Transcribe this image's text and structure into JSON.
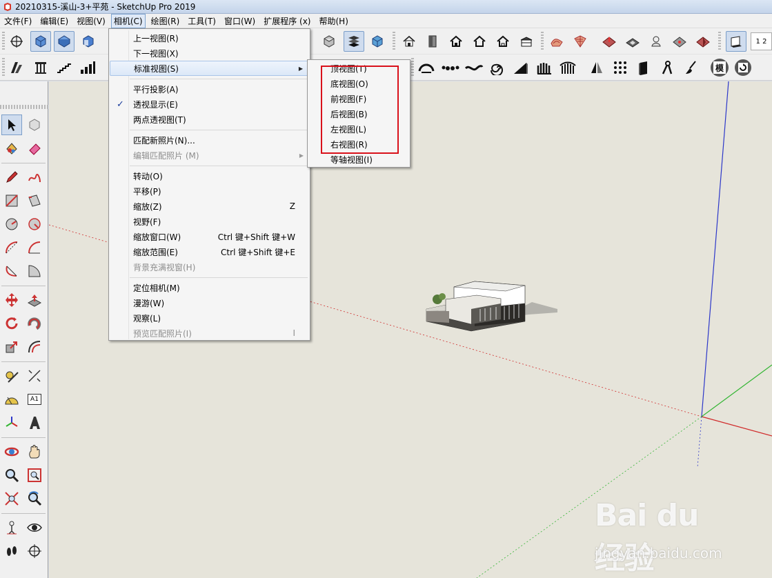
{
  "window": {
    "title": "20210315-溪山-3+平苑 - SketchUp Pro 2019"
  },
  "menubar": [
    {
      "label": "文件(F)"
    },
    {
      "label": "编辑(E)"
    },
    {
      "label": "视图(V)"
    },
    {
      "label": "相机(C)"
    },
    {
      "label": "绘图(R)"
    },
    {
      "label": "工具(T)"
    },
    {
      "label": "窗口(W)"
    },
    {
      "label": "扩展程序 (x)"
    },
    {
      "label": "帮助(H)"
    }
  ],
  "camera_menu": {
    "items": [
      {
        "label": "上一视图(R)"
      },
      {
        "label": "下一视图(X)"
      },
      {
        "label": "标准视图(S)"
      },
      {
        "label": "平行投影(A)"
      },
      {
        "label": "透视显示(E)"
      },
      {
        "label": "两点透视图(T)"
      },
      {
        "label": "匹配新照片(N)..."
      },
      {
        "label": "编辑匹配照片 (M)"
      },
      {
        "label": "转动(O)"
      },
      {
        "label": "平移(P)"
      },
      {
        "label": "缩放(Z)",
        "shortcut": "Z"
      },
      {
        "label": "视野(F)"
      },
      {
        "label": "缩放窗口(W)",
        "shortcut": "Ctrl 键+Shift 键+W"
      },
      {
        "label": "缩放范围(E)",
        "shortcut": "Ctrl 键+Shift 键+E"
      },
      {
        "label": "背景充满视窗(H)"
      },
      {
        "label": "定位相机(M)"
      },
      {
        "label": "漫游(W)"
      },
      {
        "label": "观察(L)"
      },
      {
        "label": "预览匹配照片(I)",
        "shortcut": "I"
      }
    ]
  },
  "standard_views_submenu": {
    "items": [
      {
        "label": "顶视图(T)"
      },
      {
        "label": "底视图(O)"
      },
      {
        "label": "前视图(F)"
      },
      {
        "label": "后视图(B)"
      },
      {
        "label": "左视图(L)"
      },
      {
        "label": "右视图(R)"
      },
      {
        "label": "等轴视图(I)"
      }
    ]
  },
  "toolbar_icons": {
    "row1": [
      "orbit-origin-icon",
      "iso-view-icon",
      "top-view-icon",
      "front-view-icon",
      "component-icon",
      "box-icon",
      "layers-icon",
      "cube-icon",
      "house-icon",
      "door-icon",
      "house-outline-icon",
      "house-small-icon",
      "building-icon",
      "sandbox-icon",
      "grid-icon",
      "terrain-icon",
      "stamp-icon",
      "drape-icon",
      "flip-icon",
      "shadow-icon"
    ],
    "row2": [
      "stairs-icon",
      "column-icon",
      "stair-line-icon",
      "bars-icon",
      "arc-icon",
      "dots-icon",
      "wave-icon",
      "spiral-icon",
      "slope-icon",
      "comb-icon",
      "rail-icon",
      "mirror-icon",
      "dot-grid-icon",
      "panel-icon",
      "compass-icon",
      "brush-icon",
      "model-icon",
      "cycle-icon"
    ],
    "model_button_label": "模",
    "page_tab_label": "1 2"
  },
  "left_tools": [
    "select-icon",
    "component-icon",
    "paint-bucket-icon",
    "eraser-icon",
    "pencil-icon",
    "freehand-icon",
    "rectangle-icon",
    "rotated-rect-icon",
    "circle-icon",
    "polygon-icon",
    "arc-icon",
    "two-point-arc-icon",
    "three-point-arc-icon",
    "pie-icon",
    "move-icon",
    "push-pull-icon",
    "rotate-icon",
    "follow-me-icon",
    "scale-icon",
    "offset-icon",
    "tape-measure-icon",
    "dimension-icon",
    "protractor-icon",
    "text-icon",
    "axes-icon",
    "3d-text-icon",
    "orbit-icon",
    "pan-icon",
    "zoom-icon",
    "zoom-window-icon",
    "zoom-extents-icon",
    "previous-icon",
    "position-camera-icon",
    "look-around-icon",
    "walk-icon",
    "section-plane-icon"
  ],
  "left_tools_text_label": "A1",
  "colors": {
    "canvas_bg": "#e6e4da",
    "menu_highlight": "#dce8f8",
    "annotation_box": "#d9101a",
    "axis_blue": "#2b36c9",
    "axis_red": "#d02b2b",
    "axis_green": "#33b533"
  },
  "watermark": {
    "logo": "Bai du 经验",
    "url": "jingyan.baidu.com"
  }
}
